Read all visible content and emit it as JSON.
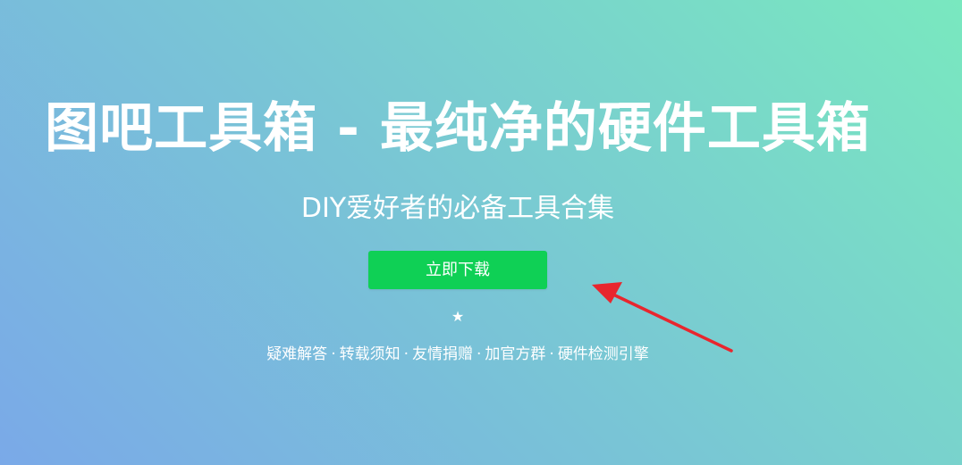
{
  "hero": {
    "title": "图吧工具箱 - 最纯净的硬件工具箱",
    "subtitle": "DIY爱好者的必备工具合集",
    "download_label": "立即下载",
    "star_glyph": "★"
  },
  "links": [
    {
      "label": "疑难解答"
    },
    {
      "label": "转载须知"
    },
    {
      "label": "友情捐赠"
    },
    {
      "label": "加官方群"
    },
    {
      "label": "硬件检测引擎"
    }
  ],
  "link_separator": "·",
  "colors": {
    "background_start": "#7aa9e8",
    "background_end": "#79e8bf",
    "button": "#0fd055",
    "annotation_arrow": "#e8262e",
    "text": "#ffffff"
  },
  "icons": {
    "star": "star-icon",
    "annotation": "red-arrow-icon"
  }
}
